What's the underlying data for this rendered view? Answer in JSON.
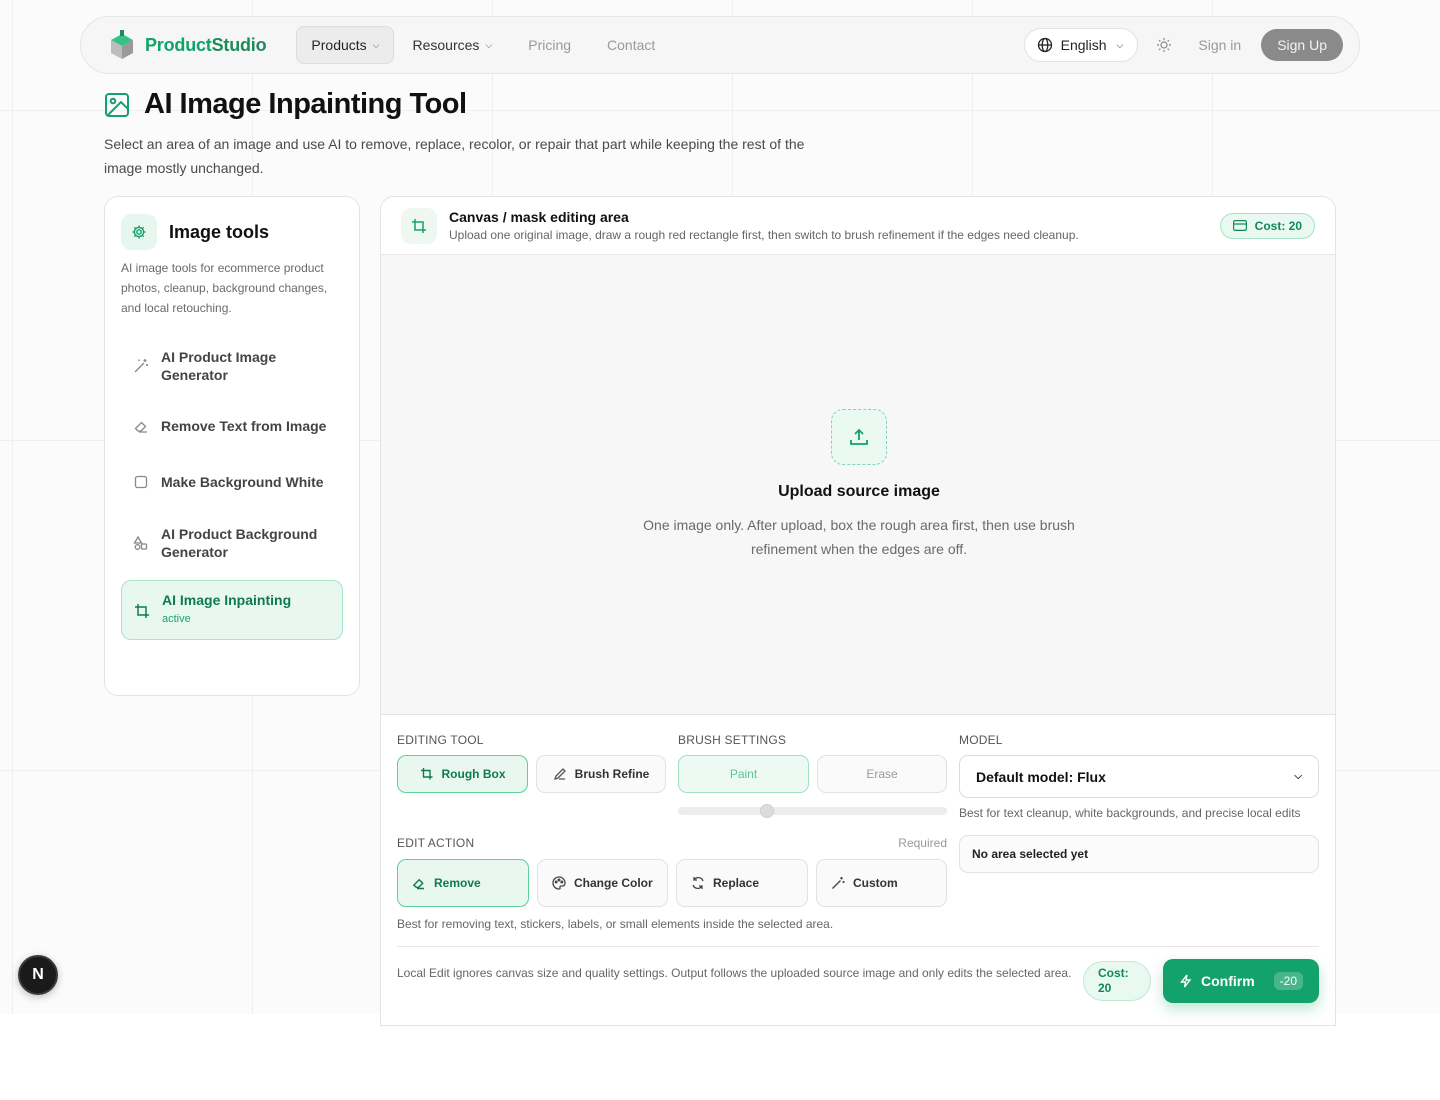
{
  "nav": {
    "brand_a": "Product",
    "brand_b": "Studio",
    "links": [
      {
        "label": "Products",
        "has_menu": true
      },
      {
        "label": "Resources",
        "has_menu": true
      },
      {
        "label": "Pricing"
      },
      {
        "label": "Contact"
      }
    ],
    "language": "English",
    "sign_in": "Sign in",
    "sign_up": "Sign Up"
  },
  "page": {
    "title": "AI Image Inpainting Tool",
    "description": "Select an area of an image and use AI to remove, replace, recolor, or repair that part while keeping the rest of the image mostly unchanged."
  },
  "sidebar": {
    "title": "Image tools",
    "description": "AI image tools for ecommerce product photos, cleanup, background changes, and local retouching.",
    "items": [
      {
        "label": "AI Product Image Generator",
        "icon": "magic-wand-icon"
      },
      {
        "label": "Remove Text from Image",
        "icon": "eraser-icon"
      },
      {
        "label": "Make Background White",
        "icon": "square-icon"
      },
      {
        "label": "AI Product Background Generator",
        "icon": "shapes-icon"
      },
      {
        "label": "AI Image Inpainting",
        "sub": "active",
        "icon": "crop-icon"
      }
    ]
  },
  "editor": {
    "title": "Canvas / mask editing area",
    "subtitle": "Upload one original image, draw a rough red rectangle first, then switch to brush refinement if the edges need cleanup.",
    "cost_label": "Cost: 20",
    "upload_title": "Upload source image",
    "upload_desc": "One image only. After upload, box the rough area first, then use brush refinement when the edges are off."
  },
  "controls": {
    "editing_tool_label": "EDITING TOOL",
    "rough_box": "Rough Box",
    "brush_refine": "Brush Refine",
    "brush_settings_label": "BRUSH SETTINGS",
    "paint": "Paint",
    "erase": "Erase",
    "brush_size": 0.32,
    "model_label": "MODEL",
    "model_value": "Default model: Flux",
    "model_hint": "Best for text cleanup, white backgrounds, and precise local edits",
    "area_status": "No area selected yet",
    "edit_action_label": "EDIT ACTION",
    "required": "Required",
    "actions": [
      "Remove",
      "Change Color",
      "Replace",
      "Custom"
    ],
    "action_hint": "Best for removing text, stickers, labels, or small elements inside the selected area.",
    "footer_note": "Local Edit ignores canvas size and quality settings. Output follows the uploaded source image and only edits the selected area.",
    "footer_cost_line1": "Cost:",
    "footer_cost_line2": "20",
    "confirm": "Confirm",
    "confirm_cost": "-20"
  },
  "dev_badge": "N",
  "colors": {
    "accent": "#14a26c",
    "accent_light": "#e8f8f0",
    "signup_bg": "#8a8a8a"
  }
}
